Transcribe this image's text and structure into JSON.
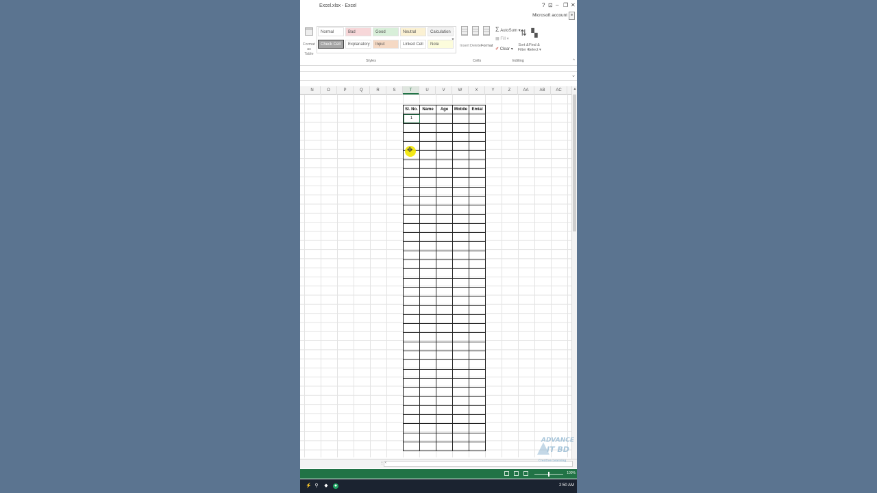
{
  "window": {
    "title": "Excel.xlsx - Excel",
    "controls": [
      "?",
      "⊡",
      "–",
      "❐",
      "✕"
    ],
    "account": "Microsoft account"
  },
  "ribbon": {
    "format_as_table": [
      "Format as",
      "Table"
    ],
    "styles_label": "Styles",
    "styles": [
      {
        "label": "Normal",
        "bg": "#ffffff"
      },
      {
        "label": "Bad",
        "bg": "#f7d7d9"
      },
      {
        "label": "Good",
        "bg": "#d8efd9"
      },
      {
        "label": "Neutral",
        "bg": "#fbf1d3"
      },
      {
        "label": "Calculation",
        "bg": "#f2f2f2"
      },
      {
        "label": "Check Cell",
        "bg": "#a5a5a5"
      },
      {
        "label": "Explanatory ...",
        "bg": "#ffffff"
      },
      {
        "label": "Input",
        "bg": "#f5d9c4"
      },
      {
        "label": "Linked Cell",
        "bg": "#ffffff"
      },
      {
        "label": "Note",
        "bg": "#fcfcdc"
      }
    ],
    "cells_label": "Cells",
    "cells_buttons": [
      "Insert",
      "Delete",
      "Format"
    ],
    "editing_label": "Editing",
    "autosum": "AutoSum",
    "fill": "Fill",
    "clear": "Clear",
    "sort_filter": [
      "Sort &",
      "Filter"
    ],
    "find_select": [
      "Find &",
      "Select"
    ]
  },
  "columns": [
    "N",
    "O",
    "P",
    "Q",
    "R",
    "S",
    "T",
    "U",
    "V",
    "W",
    "X",
    "Y",
    "Z",
    "AA",
    "AB",
    "AC"
  ],
  "selected_column": "T",
  "table": {
    "headers": [
      "Sl. No.",
      "Name",
      "Age",
      "Mobile",
      "Emial"
    ],
    "first_value": "1",
    "row_count": 37
  },
  "status": {
    "zoom": "100%"
  },
  "taskbar": {
    "time": "2:50 AM"
  },
  "watermark": [
    "ADVANCE",
    "IT BD",
    "Creative Learning"
  ],
  "accent": "#217346"
}
